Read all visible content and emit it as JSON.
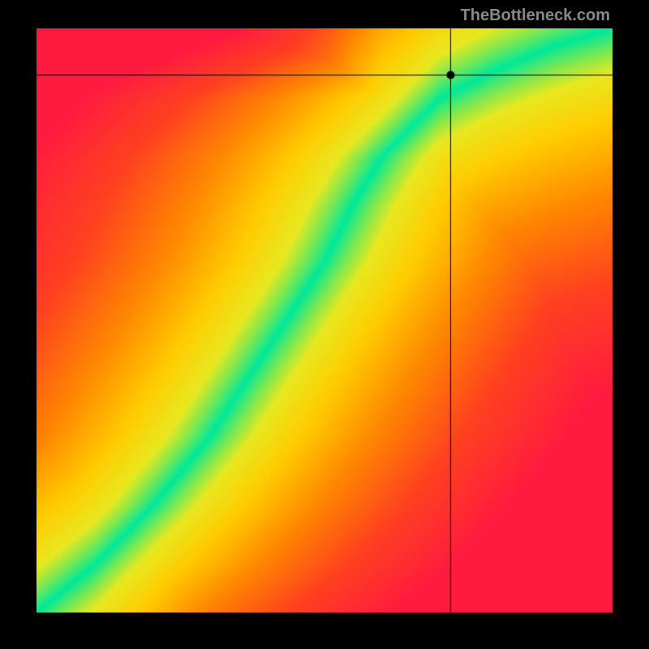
{
  "attribution": "TheBottleneck.com",
  "chart_data": {
    "type": "heatmap",
    "title": "",
    "xlabel": "",
    "ylabel": "",
    "xlim": [
      0,
      100
    ],
    "ylim": [
      0,
      100
    ],
    "crosshair": {
      "x": 72,
      "y": 92
    },
    "marker": {
      "x": 72,
      "y": 92
    },
    "optimal_curve": [
      {
        "x": 0,
        "y": 0
      },
      {
        "x": 10,
        "y": 8
      },
      {
        "x": 20,
        "y": 18
      },
      {
        "x": 30,
        "y": 30
      },
      {
        "x": 40,
        "y": 45
      },
      {
        "x": 50,
        "y": 60
      },
      {
        "x": 55,
        "y": 70
      },
      {
        "x": 60,
        "y": 78
      },
      {
        "x": 70,
        "y": 88
      },
      {
        "x": 80,
        "y": 93
      },
      {
        "x": 90,
        "y": 97
      },
      {
        "x": 100,
        "y": 100
      }
    ],
    "color_stops": [
      {
        "dist": 0.0,
        "color": "#00e89a"
      },
      {
        "dist": 0.06,
        "color": "#7ee850"
      },
      {
        "dist": 0.12,
        "color": "#e8e820"
      },
      {
        "dist": 0.25,
        "color": "#ffcc00"
      },
      {
        "dist": 0.45,
        "color": "#ff8800"
      },
      {
        "dist": 0.7,
        "color": "#ff4020"
      },
      {
        "dist": 1.0,
        "color": "#ff1a40"
      }
    ]
  }
}
